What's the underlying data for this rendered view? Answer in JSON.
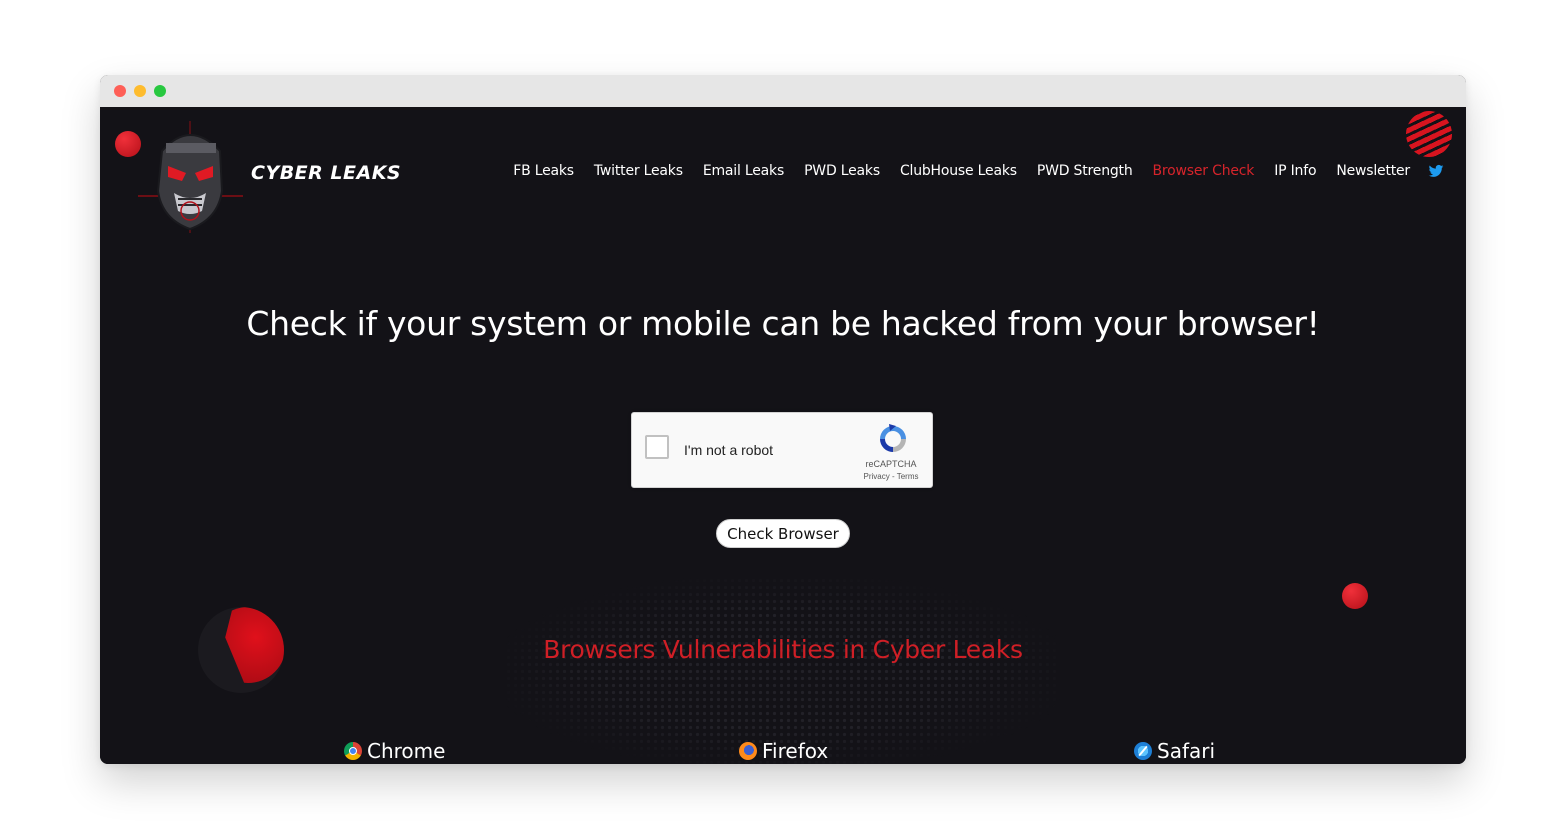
{
  "brand": {
    "name": "CYBER LEAKS"
  },
  "nav": {
    "items": [
      {
        "label": "FB Leaks",
        "active": false
      },
      {
        "label": "Twitter Leaks",
        "active": false
      },
      {
        "label": "Email Leaks",
        "active": false
      },
      {
        "label": "PWD Leaks",
        "active": false
      },
      {
        "label": "ClubHouse Leaks",
        "active": false
      },
      {
        "label": "PWD Strength",
        "active": false
      },
      {
        "label": "Browser Check",
        "active": true
      },
      {
        "label": "IP Info",
        "active": false
      },
      {
        "label": "Newsletter",
        "active": false
      }
    ],
    "social_icon": "twitter-icon"
  },
  "hero": {
    "title": "Check if your system or mobile can be hacked from your browser!"
  },
  "recaptcha": {
    "label": "I'm not a robot",
    "brand": "reCAPTCHA",
    "links": "Privacy - Terms",
    "checked": false
  },
  "check_button": {
    "label": "Check Browser"
  },
  "vulnerabilities": {
    "title": "Browsers Vulnerabilities in Cyber Leaks",
    "browsers": [
      {
        "label": "Chrome",
        "icon": "chrome-icon"
      },
      {
        "label": "Firefox",
        "icon": "firefox-icon"
      },
      {
        "label": "Safari",
        "icon": "safari-icon"
      }
    ]
  },
  "colors": {
    "background": "#131217",
    "accent": "#d6242b",
    "text": "#ffffff"
  }
}
